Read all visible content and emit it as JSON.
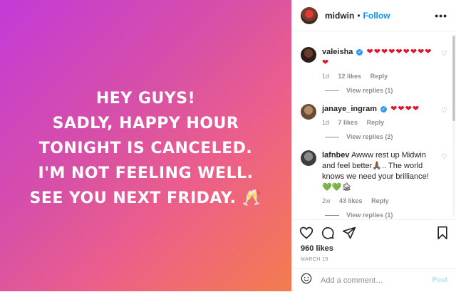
{
  "post": {
    "text_lines": [
      "HEY GUYS!",
      "SADLY, HAPPY HOUR",
      "TONIGHT IS CANCELED.",
      "I'M NOT FEELING WELL.",
      "SEE YOU NEXT FRIDAY. 🥂"
    ]
  },
  "header": {
    "username": "midwin",
    "dot": "•",
    "follow_label": "Follow",
    "more_label": "•••"
  },
  "comments": [
    {
      "user": "valeisha",
      "verified": true,
      "text": "❤❤❤❤❤❤❤❤❤❤",
      "age": "1d",
      "likes": "12 likes",
      "reply_label": "Reply",
      "view_replies": "View replies (1)"
    },
    {
      "user": "janaye_ingram",
      "verified": true,
      "text": "❤❤❤❤",
      "age": "1d",
      "likes": "7 likes",
      "reply_label": "Reply",
      "view_replies": "View replies (2)"
    },
    {
      "user": "lafnbev",
      "verified": false,
      "text": "Awww rest up Midwin and feel better🙏🏾.. The world knows we need your brilliance! 💚💚🏚",
      "age": "2w",
      "likes": "43 likes",
      "reply_label": "Reply",
      "view_replies": "View replies (1)"
    }
  ],
  "actions": {
    "likes": "960 likes",
    "date": "MARCH 19"
  },
  "add_comment": {
    "placeholder": "Add a comment…",
    "post_label": "Post"
  },
  "colors": {
    "accent": "#0095f6",
    "heart": "#e0162b",
    "gradient_start": "#c43ad8",
    "gradient_end": "#f47c4e"
  }
}
